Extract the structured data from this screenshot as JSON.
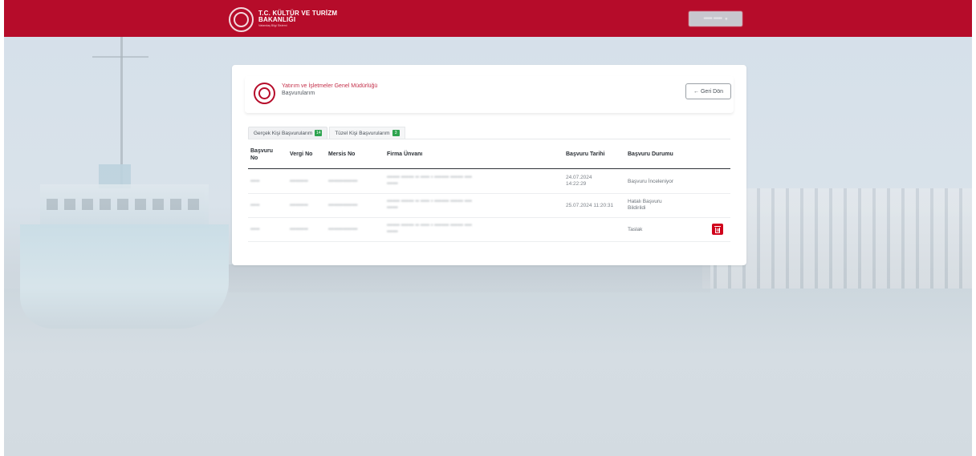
{
  "header": {
    "logo_title_line1": "T.C. KÜLTÜR VE TURİZM",
    "logo_title_line2": "BAKANLIĞI",
    "logo_subtitle": "Vatandaş Bilgi Sistemi",
    "user_name": "••••• •••••"
  },
  "card": {
    "title": "Yatırım ve İşletmeler Genel Müdürlüğü",
    "subtitle": "Başvurularım",
    "back_button": "Geri Dön"
  },
  "tabs": [
    {
      "label": "Gerçek Kişi Başvurularım",
      "count": "14",
      "active": true
    },
    {
      "label": "Tüzel Kişi Başvurularım",
      "count": "3",
      "active": false
    }
  ],
  "table": {
    "columns": {
      "basvuru_no": "Başvuru No",
      "vergi_no": "Vergi No",
      "mersis_no": "Mersis No",
      "firma_unvani": "Firma Ünvanı",
      "basvuru_tarihi": "Başvuru Tarihi",
      "basvuru_durumu": "Başvuru Durumu"
    },
    "rows": [
      {
        "basvuru_no": "•••••",
        "vergi_no": "••••••••••",
        "mersis_no": "••••••••••••••••",
        "firma_unvani_line1": "••••••• ••••••• •• ••••• • •••••••• ••••••• ••••",
        "firma_unvani_line2": "••••••",
        "basvuru_tarihi": "24.07.2024 14:22:29",
        "basvuru_durumu": "Başvuru İnceleniyor"
      },
      {
        "basvuru_no": "•••••",
        "vergi_no": "••••••••••",
        "mersis_no": "••••••••••••••••",
        "firma_unvani_line1": "••••••• ••••••• •• ••••• • •••••••• ••••••• ••••",
        "firma_unvani_line2": "••••••",
        "basvuru_tarihi": "25.07.2024 11:20:31",
        "basvuru_durumu": "Hatalı Başvuru Bildirildi"
      },
      {
        "basvuru_no": "•••••",
        "vergi_no": "••••••••••",
        "mersis_no": "••••••••••••••••",
        "firma_unvani_line1": "••••••• ••••••• •• ••••• • •••••••• ••••••• ••••",
        "firma_unvani_line2": "••••••",
        "basvuru_tarihi": "",
        "basvuru_durumu": "Taslak",
        "deletable": true
      }
    ]
  },
  "colors": {
    "brand_red": "#b60c2a",
    "badge_green": "#2ea44f",
    "delete_red": "#d0021b"
  },
  "icons": {
    "back": "arrow-left-icon",
    "delete": "trash-icon",
    "user_menu": "chevron-down-icon",
    "logo": "ministry-seal-icon"
  }
}
